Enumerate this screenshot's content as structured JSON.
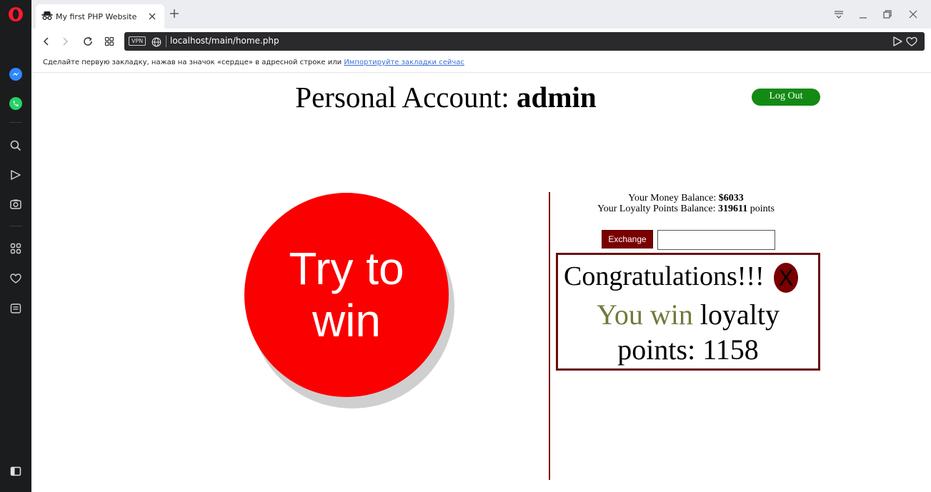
{
  "browser": {
    "tab_title": "My first PHP Website",
    "vpn_label": "VPN",
    "url": "localhost/main/home.php",
    "bookmarks_hint": "Сделайте первую закладку, нажав на значок «сердце» в адресной строке или",
    "bookmarks_link": "Импортируйте закладки сейчас"
  },
  "colors": {
    "opera_red": "#ff1b2d",
    "try_button": "#fa0000",
    "logout_button": "#138a13",
    "accent_dark_red": "#7a0000",
    "win_text": "#6f7a3a"
  },
  "header": {
    "title_prefix": "Personal Account:",
    "username": "admin",
    "logout_label": "Log Out"
  },
  "game": {
    "try_label": "Try to win"
  },
  "balance": {
    "money_label": "Your Money Balance:",
    "money_value": "$6033",
    "loyalty_label": "Your Loyalty Points Balance:",
    "loyalty_value": "319611",
    "loyalty_unit": "points"
  },
  "exchange": {
    "button_label": "Exchange",
    "input_value": ""
  },
  "popup": {
    "line1": "Congratulations!!!",
    "close_label": "X",
    "win_text": "You win",
    "line2_rest": "loyalty",
    "line3": "points: 1158"
  }
}
